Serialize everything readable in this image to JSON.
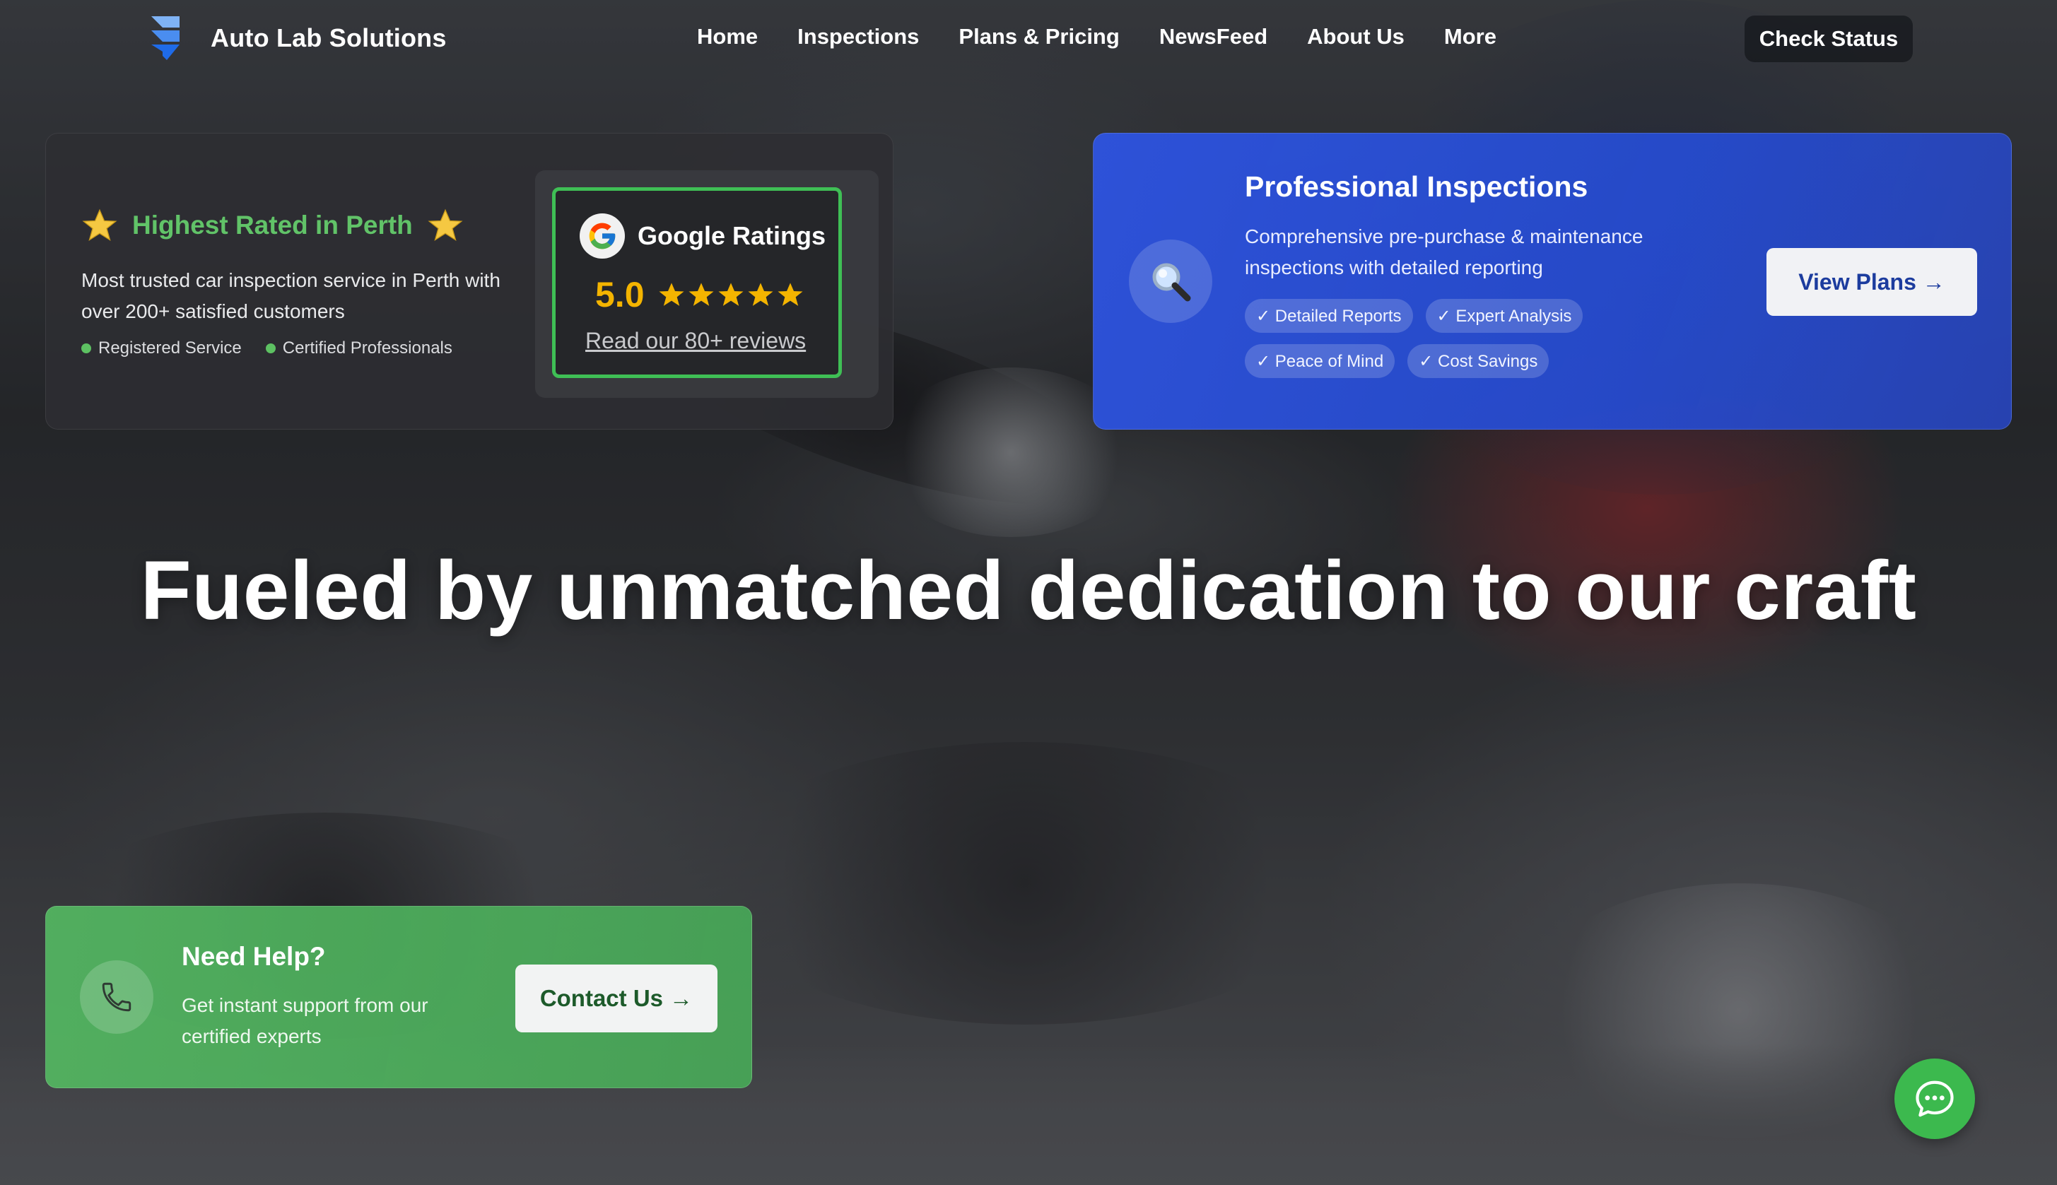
{
  "brand": {
    "name": "Auto Lab Solutions",
    "logo_icon": "stacked-chevron-logo"
  },
  "nav": {
    "items": [
      {
        "label": "Home"
      },
      {
        "label": "Inspections"
      },
      {
        "label": "Plans & Pricing"
      },
      {
        "label": "NewsFeed"
      },
      {
        "label": "About Us"
      },
      {
        "label": "More"
      }
    ],
    "check_status": "Check Status"
  },
  "rated_card": {
    "title": "Highest Rated in Perth",
    "description": "Most trusted car inspection service in Perth with over 200+ satisfied customers",
    "tags": [
      "Registered Service",
      "Certified Professionals"
    ],
    "google": {
      "title": "Google Ratings",
      "score": "5.0",
      "stars": 5,
      "link": "Read our 80+ reviews"
    }
  },
  "pro_card": {
    "icon": "magnifier-icon",
    "title": "Professional Inspections",
    "description": "Comprehensive pre-purchase & maintenance inspections with detailed reporting",
    "chips": [
      "✓ Detailed Reports",
      "✓ Expert Analysis",
      "✓ Peace of Mind",
      "✓ Cost Savings"
    ],
    "button": "View Plans →"
  },
  "hero": {
    "headline": "Fueled by unmatched dedication to our craft"
  },
  "help_card": {
    "icon": "phone-icon",
    "title": "Need Help?",
    "description": "Get instant support from our certified experts",
    "button": "Contact Us →"
  },
  "chat": {
    "icon": "chat-bubble-icon"
  },
  "colors": {
    "rated_green": "#61c368",
    "google_gold": "#f4b400",
    "pro_blue": "#2e54e1",
    "help_green": "#54b862",
    "chat_green": "#3cb94e"
  }
}
